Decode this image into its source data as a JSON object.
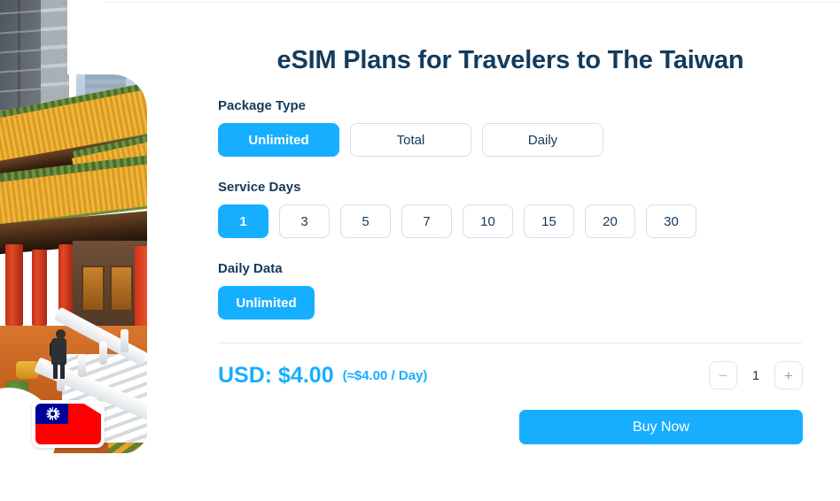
{
  "page": {
    "title": "eSIM Plans for Travelers to The Taiwan"
  },
  "hero": {
    "alt": "taiwan-temple-photo",
    "flag_name": "taiwan-flag",
    "flag_colors": {
      "field": "#FE0000",
      "canton": "#000095",
      "sun": "#FFFFFF"
    }
  },
  "theme": {
    "accent": "#17AEFF",
    "title_color": "#133B5C",
    "border": "#D8DDE2"
  },
  "package_type": {
    "label": "Package Type",
    "options": [
      {
        "label": "Unlimited",
        "selected": true
      },
      {
        "label": "Total",
        "selected": false
      },
      {
        "label": "Daily",
        "selected": false
      }
    ]
  },
  "service_days": {
    "label": "Service Days",
    "options": [
      {
        "label": "1",
        "selected": true
      },
      {
        "label": "3",
        "selected": false
      },
      {
        "label": "5",
        "selected": false
      },
      {
        "label": "7",
        "selected": false
      },
      {
        "label": "10",
        "selected": false
      },
      {
        "label": "15",
        "selected": false
      },
      {
        "label": "20",
        "selected": false
      },
      {
        "label": "30",
        "selected": false
      }
    ]
  },
  "daily_data": {
    "label": "Daily Data",
    "options": [
      {
        "label": "Unlimited",
        "selected": true
      }
    ]
  },
  "pricing": {
    "main": "USD: $4.00",
    "per_day": "(≈$4.00 / Day)"
  },
  "quantity": {
    "decrement_label": "−",
    "value": "1",
    "increment_label": "+"
  },
  "cta": {
    "buy_label": "Buy Now"
  }
}
